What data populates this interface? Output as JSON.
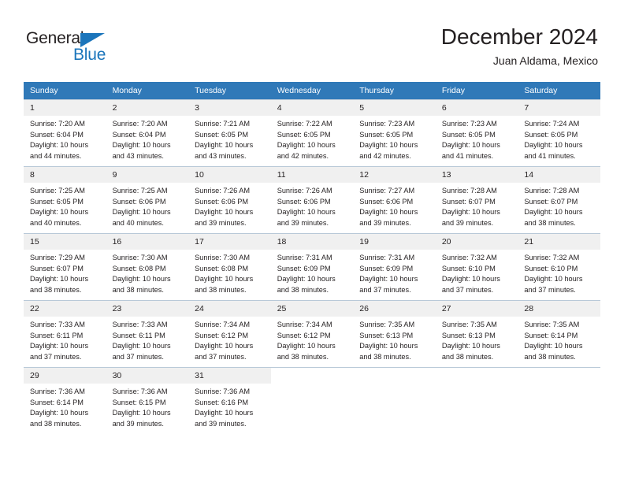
{
  "logo": {
    "word_top": "General",
    "word_bottom": "Blue",
    "triangle_icon": "blue-triangle-icon",
    "colors": {
      "black": "#231f20",
      "blue": "#1b75bb"
    }
  },
  "header": {
    "month_title": "December 2024",
    "location": "Juan Aldama, Mexico"
  },
  "colors": {
    "header_bar": "#3079b8",
    "day_number_bg": "#f0f0f0",
    "grid_line": "#b9c9d8",
    "text": "#231f20"
  },
  "weekday_headers": [
    "Sunday",
    "Monday",
    "Tuesday",
    "Wednesday",
    "Thursday",
    "Friday",
    "Saturday"
  ],
  "weeks": [
    [
      {
        "day": "1",
        "sunrise": "Sunrise: 7:20 AM",
        "sunset": "Sunset: 6:04 PM",
        "daylight_1": "Daylight: 10 hours",
        "daylight_2": "and 44 minutes."
      },
      {
        "day": "2",
        "sunrise": "Sunrise: 7:20 AM",
        "sunset": "Sunset: 6:04 PM",
        "daylight_1": "Daylight: 10 hours",
        "daylight_2": "and 43 minutes."
      },
      {
        "day": "3",
        "sunrise": "Sunrise: 7:21 AM",
        "sunset": "Sunset: 6:05 PM",
        "daylight_1": "Daylight: 10 hours",
        "daylight_2": "and 43 minutes."
      },
      {
        "day": "4",
        "sunrise": "Sunrise: 7:22 AM",
        "sunset": "Sunset: 6:05 PM",
        "daylight_1": "Daylight: 10 hours",
        "daylight_2": "and 42 minutes."
      },
      {
        "day": "5",
        "sunrise": "Sunrise: 7:23 AM",
        "sunset": "Sunset: 6:05 PM",
        "daylight_1": "Daylight: 10 hours",
        "daylight_2": "and 42 minutes."
      },
      {
        "day": "6",
        "sunrise": "Sunrise: 7:23 AM",
        "sunset": "Sunset: 6:05 PM",
        "daylight_1": "Daylight: 10 hours",
        "daylight_2": "and 41 minutes."
      },
      {
        "day": "7",
        "sunrise": "Sunrise: 7:24 AM",
        "sunset": "Sunset: 6:05 PM",
        "daylight_1": "Daylight: 10 hours",
        "daylight_2": "and 41 minutes."
      }
    ],
    [
      {
        "day": "8",
        "sunrise": "Sunrise: 7:25 AM",
        "sunset": "Sunset: 6:05 PM",
        "daylight_1": "Daylight: 10 hours",
        "daylight_2": "and 40 minutes."
      },
      {
        "day": "9",
        "sunrise": "Sunrise: 7:25 AM",
        "sunset": "Sunset: 6:06 PM",
        "daylight_1": "Daylight: 10 hours",
        "daylight_2": "and 40 minutes."
      },
      {
        "day": "10",
        "sunrise": "Sunrise: 7:26 AM",
        "sunset": "Sunset: 6:06 PM",
        "daylight_1": "Daylight: 10 hours",
        "daylight_2": "and 39 minutes."
      },
      {
        "day": "11",
        "sunrise": "Sunrise: 7:26 AM",
        "sunset": "Sunset: 6:06 PM",
        "daylight_1": "Daylight: 10 hours",
        "daylight_2": "and 39 minutes."
      },
      {
        "day": "12",
        "sunrise": "Sunrise: 7:27 AM",
        "sunset": "Sunset: 6:06 PM",
        "daylight_1": "Daylight: 10 hours",
        "daylight_2": "and 39 minutes."
      },
      {
        "day": "13",
        "sunrise": "Sunrise: 7:28 AM",
        "sunset": "Sunset: 6:07 PM",
        "daylight_1": "Daylight: 10 hours",
        "daylight_2": "and 39 minutes."
      },
      {
        "day": "14",
        "sunrise": "Sunrise: 7:28 AM",
        "sunset": "Sunset: 6:07 PM",
        "daylight_1": "Daylight: 10 hours",
        "daylight_2": "and 38 minutes."
      }
    ],
    [
      {
        "day": "15",
        "sunrise": "Sunrise: 7:29 AM",
        "sunset": "Sunset: 6:07 PM",
        "daylight_1": "Daylight: 10 hours",
        "daylight_2": "and 38 minutes."
      },
      {
        "day": "16",
        "sunrise": "Sunrise: 7:30 AM",
        "sunset": "Sunset: 6:08 PM",
        "daylight_1": "Daylight: 10 hours",
        "daylight_2": "and 38 minutes."
      },
      {
        "day": "17",
        "sunrise": "Sunrise: 7:30 AM",
        "sunset": "Sunset: 6:08 PM",
        "daylight_1": "Daylight: 10 hours",
        "daylight_2": "and 38 minutes."
      },
      {
        "day": "18",
        "sunrise": "Sunrise: 7:31 AM",
        "sunset": "Sunset: 6:09 PM",
        "daylight_1": "Daylight: 10 hours",
        "daylight_2": "and 38 minutes."
      },
      {
        "day": "19",
        "sunrise": "Sunrise: 7:31 AM",
        "sunset": "Sunset: 6:09 PM",
        "daylight_1": "Daylight: 10 hours",
        "daylight_2": "and 37 minutes."
      },
      {
        "day": "20",
        "sunrise": "Sunrise: 7:32 AM",
        "sunset": "Sunset: 6:10 PM",
        "daylight_1": "Daylight: 10 hours",
        "daylight_2": "and 37 minutes."
      },
      {
        "day": "21",
        "sunrise": "Sunrise: 7:32 AM",
        "sunset": "Sunset: 6:10 PM",
        "daylight_1": "Daylight: 10 hours",
        "daylight_2": "and 37 minutes."
      }
    ],
    [
      {
        "day": "22",
        "sunrise": "Sunrise: 7:33 AM",
        "sunset": "Sunset: 6:11 PM",
        "daylight_1": "Daylight: 10 hours",
        "daylight_2": "and 37 minutes."
      },
      {
        "day": "23",
        "sunrise": "Sunrise: 7:33 AM",
        "sunset": "Sunset: 6:11 PM",
        "daylight_1": "Daylight: 10 hours",
        "daylight_2": "and 37 minutes."
      },
      {
        "day": "24",
        "sunrise": "Sunrise: 7:34 AM",
        "sunset": "Sunset: 6:12 PM",
        "daylight_1": "Daylight: 10 hours",
        "daylight_2": "and 37 minutes."
      },
      {
        "day": "25",
        "sunrise": "Sunrise: 7:34 AM",
        "sunset": "Sunset: 6:12 PM",
        "daylight_1": "Daylight: 10 hours",
        "daylight_2": "and 38 minutes."
      },
      {
        "day": "26",
        "sunrise": "Sunrise: 7:35 AM",
        "sunset": "Sunset: 6:13 PM",
        "daylight_1": "Daylight: 10 hours",
        "daylight_2": "and 38 minutes."
      },
      {
        "day": "27",
        "sunrise": "Sunrise: 7:35 AM",
        "sunset": "Sunset: 6:13 PM",
        "daylight_1": "Daylight: 10 hours",
        "daylight_2": "and 38 minutes."
      },
      {
        "day": "28",
        "sunrise": "Sunrise: 7:35 AM",
        "sunset": "Sunset: 6:14 PM",
        "daylight_1": "Daylight: 10 hours",
        "daylight_2": "and 38 minutes."
      }
    ],
    [
      {
        "day": "29",
        "sunrise": "Sunrise: 7:36 AM",
        "sunset": "Sunset: 6:14 PM",
        "daylight_1": "Daylight: 10 hours",
        "daylight_2": "and 38 minutes."
      },
      {
        "day": "30",
        "sunrise": "Sunrise: 7:36 AM",
        "sunset": "Sunset: 6:15 PM",
        "daylight_1": "Daylight: 10 hours",
        "daylight_2": "and 39 minutes."
      },
      {
        "day": "31",
        "sunrise": "Sunrise: 7:36 AM",
        "sunset": "Sunset: 6:16 PM",
        "daylight_1": "Daylight: 10 hours",
        "daylight_2": "and 39 minutes."
      },
      {
        "day": "",
        "sunrise": "",
        "sunset": "",
        "daylight_1": "",
        "daylight_2": ""
      },
      {
        "day": "",
        "sunrise": "",
        "sunset": "",
        "daylight_1": "",
        "daylight_2": ""
      },
      {
        "day": "",
        "sunrise": "",
        "sunset": "",
        "daylight_1": "",
        "daylight_2": ""
      },
      {
        "day": "",
        "sunrise": "",
        "sunset": "",
        "daylight_1": "",
        "daylight_2": ""
      }
    ]
  ]
}
